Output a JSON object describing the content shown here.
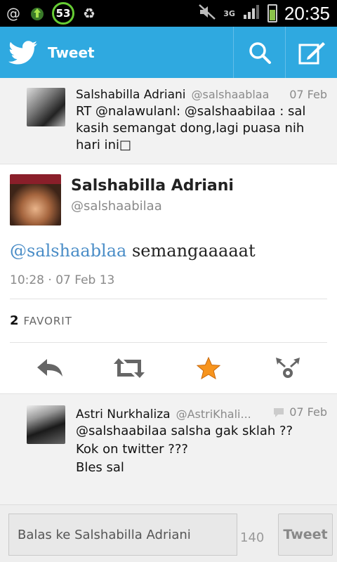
{
  "statusbar": {
    "badge": "53",
    "network": "3G",
    "time": "20:35"
  },
  "actionbar": {
    "title": "Tweet"
  },
  "parent_tweet": {
    "name": "Salshabilla Adriani",
    "handle": "@salshaablaa",
    "date": "07 Feb",
    "text": "RT @nalawulanl: @salshaabilaa : sal kasih semangat dong,lagi puasa nih hari ini□"
  },
  "main_tweet": {
    "name": "Salshabilla Adriani",
    "handle": "@salshaabilaa",
    "mention": "@salshaablaa",
    "text": " semangaaaaat",
    "timestamp": "10:28 · 07 Feb 13",
    "favorites_count": "2",
    "favorites_label": "FAVORIT"
  },
  "reply_tweet": {
    "name": "Astri Nurkhaliza",
    "handle": "@AstriKhali...",
    "date": "07 Feb",
    "text_line1": "@salshaabilaa salsha gak sklah ??",
    "text_line2": "Kok on twitter ???",
    "text_line3": "Bles sal"
  },
  "replybar": {
    "placeholder": "Balas ke Salshabilla Adriani",
    "counter": "140",
    "button": "Tweet"
  },
  "colors": {
    "brand": "#2fa9e0",
    "mention": "#4a8dc7",
    "star": "#f7941d"
  }
}
